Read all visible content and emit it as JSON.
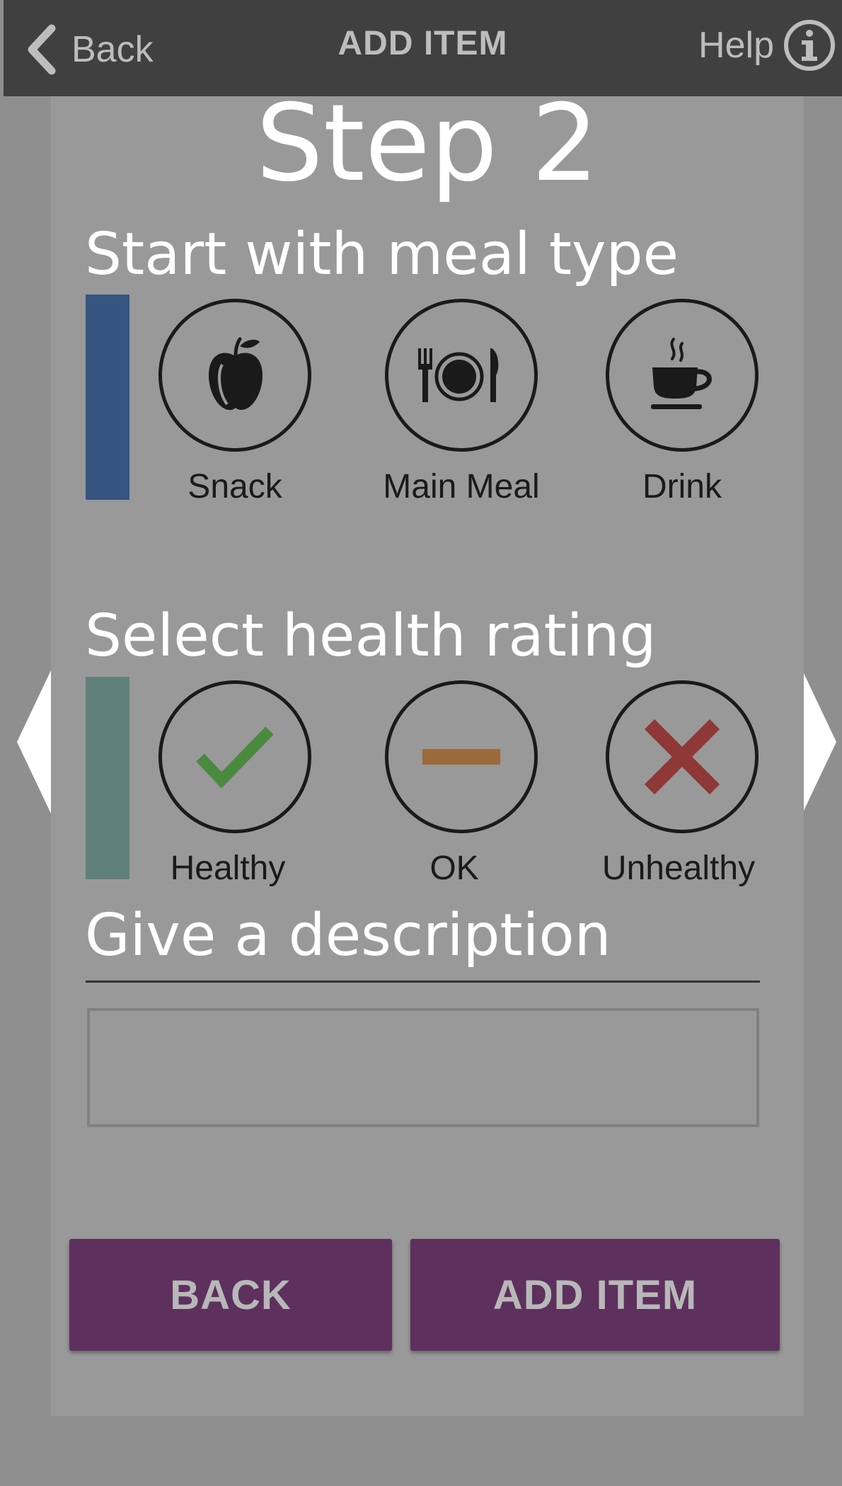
{
  "nav": {
    "back_label": "Back",
    "title": "ADD ITEM",
    "help_label": "Help"
  },
  "step": {
    "title": "Step 2"
  },
  "meal": {
    "heading": "Start with meal type",
    "accent_color": "#355580",
    "options": [
      {
        "label": "Snack",
        "icon": "apple-icon"
      },
      {
        "label": "Main Meal",
        "icon": "plate-cutlery-icon"
      },
      {
        "label": "Drink",
        "icon": "coffee-cup-icon"
      }
    ]
  },
  "health": {
    "heading": "Select health rating",
    "accent_color": "#5f8078",
    "options": [
      {
        "label": "Healthy",
        "icon": "checkmark-icon",
        "color": "#4a8a3f"
      },
      {
        "label": "OK",
        "icon": "dash-icon",
        "color": "#9a6a3a"
      },
      {
        "label": "Unhealthy",
        "icon": "cross-icon",
        "color": "#8e3838"
      }
    ]
  },
  "description": {
    "heading": "Give a description",
    "value": "",
    "placeholder": ""
  },
  "buttons": {
    "back_label": "BACK",
    "add_label": "ADD ITEM",
    "color": "#5d305e"
  }
}
